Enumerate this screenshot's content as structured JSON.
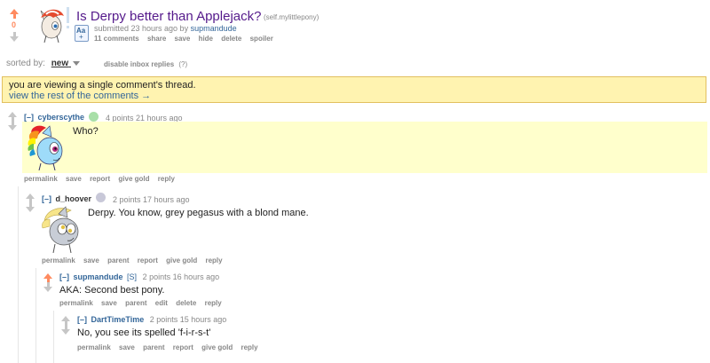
{
  "post": {
    "score": "0",
    "title": "Is Derpy better than Applejack?",
    "domain": "(self.mylittlepony)",
    "submitted_text": "submitted 23 hours ago by",
    "author": "supmandude",
    "actions": [
      "11 comments",
      "share",
      "save",
      "hide",
      "delete",
      "spoiler"
    ],
    "expand_icon_label": "Aa"
  },
  "sort": {
    "label": "sorted by:",
    "value": "new",
    "disable_inbox": "disable inbox replies",
    "help": "(?)"
  },
  "thread_notice": {
    "line1": "you are viewing a single comment's thread.",
    "line2": "view the rest of the comments →"
  },
  "comments": [
    {
      "collapse": "[–]",
      "author": "cyberscythe",
      "meta": "4 points 21 hours ago",
      "body": "Who?",
      "actions": [
        "permalink",
        "save",
        "report",
        "give gold",
        "reply"
      ]
    },
    {
      "collapse": "[–]",
      "author": "d_hoover",
      "meta": "2 points 17 hours ago",
      "body": "Derpy. You know, grey pegasus with a blond mane.",
      "actions": [
        "permalink",
        "save",
        "parent",
        "report",
        "give gold",
        "reply"
      ]
    },
    {
      "collapse": "[–]",
      "author": "supmandude",
      "submitter_tag": "[S]",
      "meta": "2 points 16 hours ago",
      "body": "AKA: Second best pony.",
      "actions": [
        "permalink",
        "save",
        "parent",
        "edit",
        "delete",
        "reply"
      ]
    },
    {
      "collapse": "[–]",
      "author": "DartTimeTime",
      "meta": "2 points 15 hours ago",
      "body": "No, you see its spelled 'f-i-r-s-t'",
      "actions": [
        "permalink",
        "save",
        "parent",
        "report",
        "give gold",
        "reply"
      ]
    }
  ],
  "colors": {
    "upvote": "#ff8b60",
    "arrow_gray": "#c6c6c6",
    "title_link": "#551a8b",
    "author_link": "#336699",
    "notice_bg": "#fff3b0",
    "notice_border": "#e2c060",
    "highlight_bg": "#ffffcc"
  }
}
